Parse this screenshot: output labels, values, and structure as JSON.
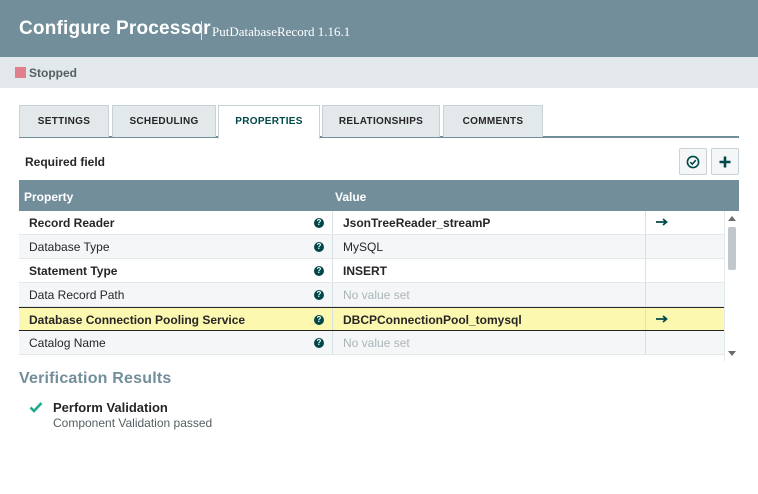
{
  "header": {
    "title": "Configure Processor",
    "subtitle": "PutDatabaseRecord 1.16.1"
  },
  "status": {
    "label": "Stopped",
    "color": "#e0808c"
  },
  "tabs": [
    {
      "label": "SETTINGS",
      "active": false
    },
    {
      "label": "SCHEDULING",
      "active": false
    },
    {
      "label": "PROPERTIES",
      "active": true
    },
    {
      "label": "RELATIONSHIPS",
      "active": false
    },
    {
      "label": "COMMENTS",
      "active": false
    }
  ],
  "properties": {
    "required_label": "Required field",
    "verify_icon": "verify-check-circle-icon",
    "add_icon": "plus-icon",
    "columns": {
      "property": "Property",
      "value": "Value"
    },
    "rows": [
      {
        "name": "Record Reader",
        "required": true,
        "value": "JsonTreeReader_streamP",
        "value_bold": true,
        "unset": false,
        "goto": true
      },
      {
        "name": "Database Type",
        "required": false,
        "value": "MySQL",
        "value_bold": false,
        "unset": false,
        "goto": false
      },
      {
        "name": "Statement Type",
        "required": true,
        "value": "INSERT",
        "value_bold": true,
        "unset": false,
        "goto": false
      },
      {
        "name": "Data Record Path",
        "required": false,
        "value": "No value set",
        "value_bold": false,
        "unset": true,
        "goto": false
      },
      {
        "name": "Database Connection Pooling Service",
        "required": true,
        "value": "DBCPConnectionPool_tomysql",
        "value_bold": true,
        "unset": false,
        "goto": true,
        "selected": true
      },
      {
        "name": "Catalog Name",
        "required": false,
        "value": "No value set",
        "value_bold": false,
        "unset": true,
        "goto": false
      }
    ]
  },
  "verification": {
    "title": "Verification Results",
    "items": [
      {
        "name": "Perform Validation",
        "message": "Component Validation passed",
        "status": "passed"
      }
    ]
  },
  "colors": {
    "header": "#728e9b",
    "accent": "#004849",
    "selected_row": "#fcf8b0",
    "pass": "#1fab89"
  }
}
